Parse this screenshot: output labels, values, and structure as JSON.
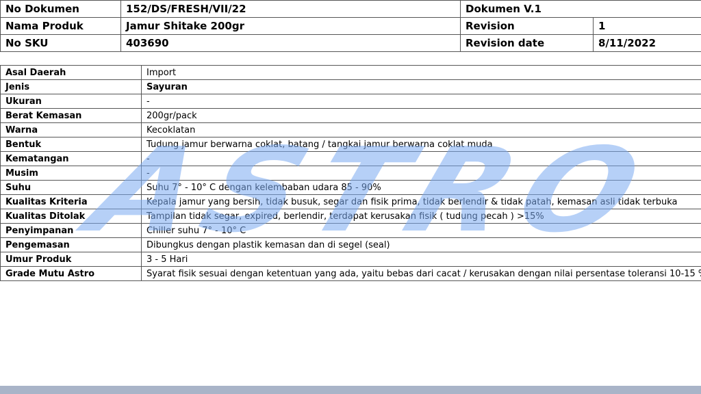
{
  "header": {
    "rows": [
      {
        "label": "No Dokumen",
        "value": "152/DS/FRESH/VII/22",
        "label2": "Dokumen V.1",
        "value2": ""
      },
      {
        "label": "Nama Produk",
        "value": "Jamur Shitake 200gr",
        "label2": "Revision",
        "value2": "1"
      },
      {
        "label": "No SKU",
        "value": "403690",
        "label2": "Revision date",
        "value2": "8/11/2022"
      }
    ]
  },
  "spec": {
    "rows": [
      {
        "key": "Asal Daerah",
        "value": "Import"
      },
      {
        "key": "Jenis",
        "value": "Sayuran"
      },
      {
        "key": "Ukuran",
        "value": "-"
      },
      {
        "key": "Berat Kemasan",
        "value": "200gr/pack"
      },
      {
        "key": "Warna",
        "value": "Kecoklatan"
      },
      {
        "key": "Bentuk",
        "value": "Tudung jamur berwarna coklat, batang / tangkai jamur berwarna coklat muda"
      },
      {
        "key": "Kematangan",
        "value": "-"
      },
      {
        "key": "Musim",
        "value": "-"
      },
      {
        "key": "Suhu",
        "value": "Suhu 7° - 10° C dengan kelembaban udara 85 - 90%"
      },
      {
        "key": "Kualitas Kriteria",
        "value": "Kepala jamur yang bersih, tidak busuk, segar dan fisik prima, tidak berlendir & tidak patah, kemasan asli tidak terbuka"
      },
      {
        "key": "Kualitas Ditolak",
        "value": "Tampilan tidak segar, expired, berlendir, terdapat kerusakan fisik ( tudung pecah ) >15%"
      },
      {
        "key": "Penyimpanan",
        "value": "Chiller suhu 7° - 10° C"
      },
      {
        "key": "Pengemasan",
        "value": "Dibungkus dengan plastik kemasan dan di segel (seal)"
      },
      {
        "key": "Umur Produk",
        "value": "3 - 5 Hari"
      },
      {
        "key": "Grade Mutu Astro",
        "value": "Syarat fisik sesuai dengan ketentuan yang ada, yaitu bebas dari cacat / kerusakan dengan nilai persentase toleransi 10-15 %"
      }
    ]
  },
  "watermark": {
    "text": "ASTRO",
    "color": "#7aaaf0"
  },
  "colors": {
    "footer_bar": "#a9b4c8",
    "border": "#555555"
  }
}
